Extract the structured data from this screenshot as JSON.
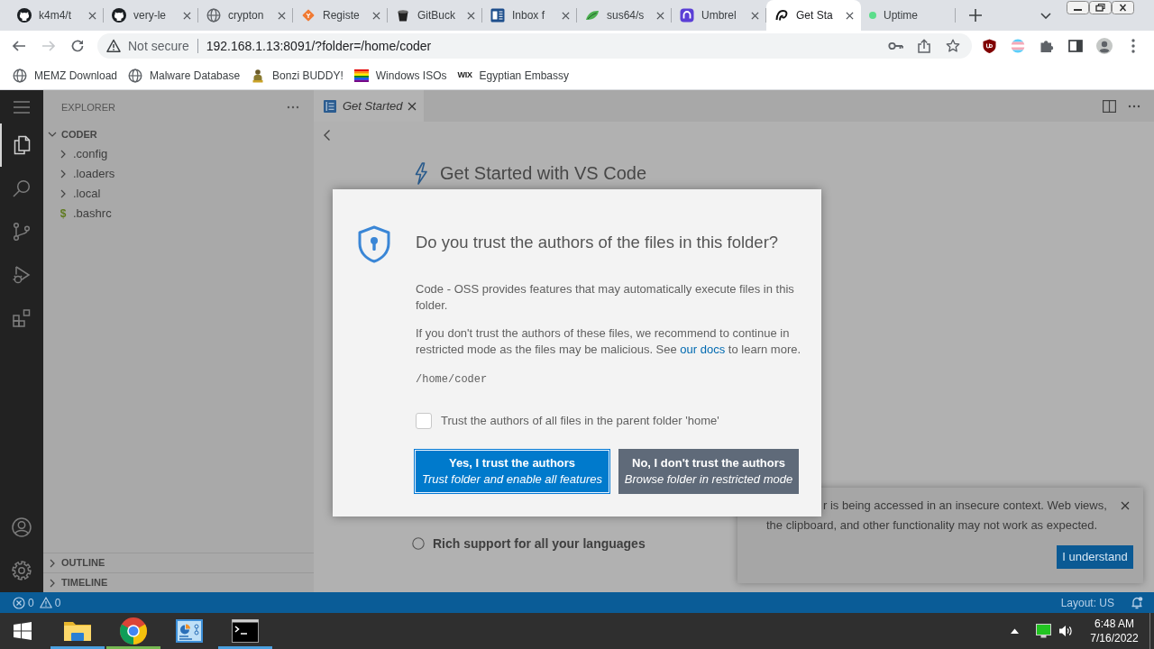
{
  "browser": {
    "tabs": [
      {
        "title": "k4m4/t",
        "selected": false,
        "closable": true
      },
      {
        "title": "very-le",
        "selected": false,
        "closable": true
      },
      {
        "title": "crypton",
        "selected": false,
        "closable": true
      },
      {
        "title": "Registe",
        "selected": false,
        "closable": true
      },
      {
        "title": "GitBuck",
        "selected": false,
        "closable": true
      },
      {
        "title": "Inbox f",
        "selected": false,
        "closable": true
      },
      {
        "title": "sus64/s",
        "selected": false,
        "closable": true
      },
      {
        "title": "Umbrel",
        "selected": false,
        "closable": true
      },
      {
        "title": "Get Sta",
        "selected": true,
        "closable": true
      },
      {
        "title": "Uptime",
        "selected": false,
        "closable": false
      }
    ],
    "nav_buttons": [
      {
        "kind": "back",
        "disabled": false
      },
      {
        "kind": "forward",
        "disabled": true
      },
      {
        "kind": "reload",
        "disabled": false
      }
    ],
    "address_bar": {
      "security": "Not secure",
      "url": "192.168.1.13:8091/?folder=/home/coder"
    },
    "bookmarks": [
      {
        "label": "MEMZ Download"
      },
      {
        "label": "Malware Database"
      },
      {
        "label": "Bonzi BUDDY!"
      },
      {
        "label": "Windows ISOs"
      },
      {
        "label": "Egyptian Embassy",
        "logo_text": "WIX"
      }
    ]
  },
  "workbench": {
    "activity_bar": {
      "top": [
        {
          "kind": "menu",
          "selected": false
        },
        {
          "kind": "explorer",
          "selected": true
        },
        {
          "kind": "search",
          "selected": false
        },
        {
          "kind": "source_control",
          "selected": false
        },
        {
          "kind": "run",
          "selected": false
        },
        {
          "kind": "extensions",
          "selected": false
        }
      ],
      "bottom": [
        {
          "kind": "accounts",
          "selected": false
        },
        {
          "kind": "settings",
          "selected": false
        }
      ]
    },
    "explorer": {
      "title": "EXPLORER",
      "tree": [
        {
          "name": "CODER",
          "kind": "folder",
          "expanded": true,
          "children": [
            {
              "name": ".config",
              "kind": "folder",
              "expanded": false
            },
            {
              "name": ".loaders",
              "kind": "folder",
              "expanded": false
            },
            {
              "name": ".local",
              "kind": "folder",
              "expanded": false
            },
            {
              "name": ".bashrc",
              "kind": "file",
              "icon_char": "$"
            }
          ]
        }
      ],
      "sections": [
        {
          "title": "OUTLINE",
          "expanded": false
        },
        {
          "title": "TIMELINE",
          "expanded": false
        }
      ]
    },
    "editor": {
      "tabs": [
        {
          "title": "Get Started",
          "selected": true
        }
      ],
      "heading": "Get Started with VS Code",
      "steps": [
        {
          "label": "Rich support for all your languages",
          "checked": false
        }
      ]
    },
    "dialog": {
      "title": "Do you trust the authors of the files in this folder?",
      "paragraphs": [
        {
          "text": "Code - OSS provides features that may automatically execute files in this folder."
        },
        {
          "text": "If you don't trust the authors of these files, we recommend to continue in restricted mode as the files may be malicious. See ",
          "link": "our docs",
          "text_after": " to learn more."
        }
      ],
      "path": "/home/coder",
      "checkbox": {
        "label": "Trust the authors of all files in the parent folder 'home'",
        "checked": false
      },
      "buttons": [
        {
          "kind": "primary",
          "label": "Yes, I trust the authors",
          "detail": "Trust folder and enable all features",
          "focused": true
        },
        {
          "kind": "secondary",
          "label": "No, I don't trust the authors",
          "detail": "Browse folder in restricted mode",
          "focused": false
        }
      ]
    },
    "notification": {
      "message_lines": [
        "r is being accessed in an insecure context. Web views,",
        "the clipboard, and other functionality may not work as expected."
      ],
      "action": "I understand"
    },
    "status_bar": {
      "errors": "0",
      "warnings": "0",
      "layout": "Layout: US"
    }
  },
  "taskbar": {
    "apps": [
      {
        "kind": "files",
        "running": true,
        "color": "#4aa0e0"
      },
      {
        "kind": "browser",
        "running": true,
        "color": "#76b852"
      },
      {
        "kind": "panel",
        "running": false
      },
      {
        "kind": "terminal",
        "running": true,
        "color": "#4aa0e0"
      }
    ],
    "time": "6:48 AM",
    "date": "7/16/2022"
  }
}
